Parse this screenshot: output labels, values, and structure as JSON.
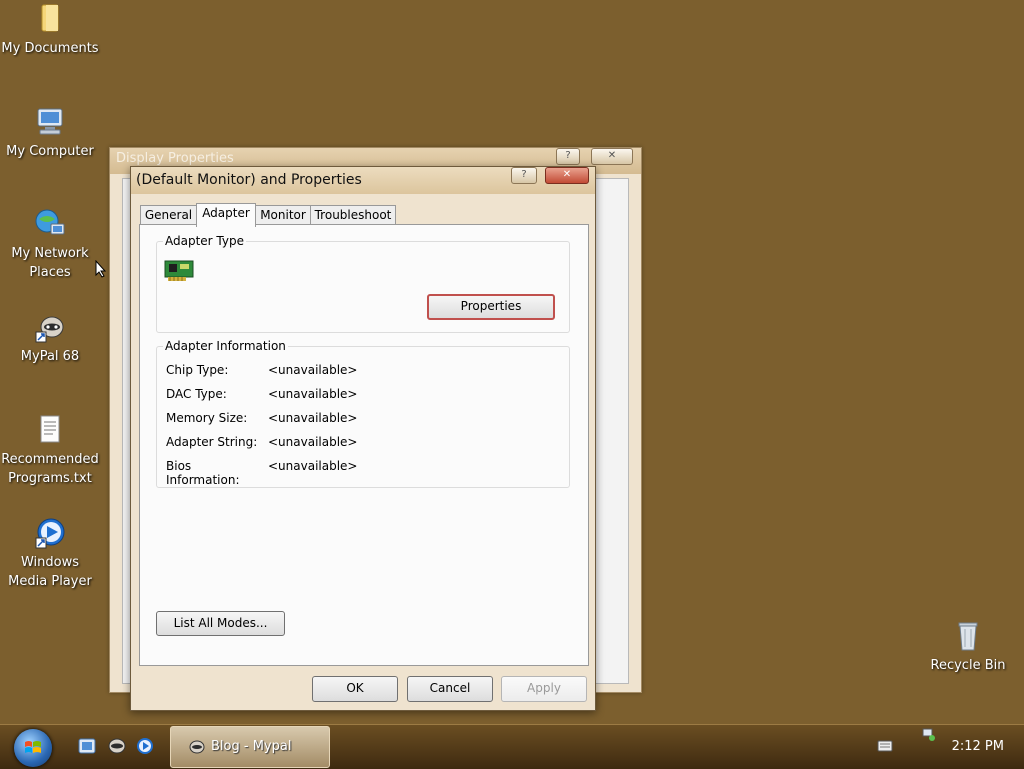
{
  "desktop": {
    "icons": [
      {
        "label": "My Documents",
        "icon": "folder-icon"
      },
      {
        "label": "My Computer",
        "icon": "computer-icon"
      },
      {
        "label": "My Network Places",
        "icon": "network-icon"
      },
      {
        "label": "MyPal 68",
        "icon": "mypal-icon"
      },
      {
        "label": "Recommended Programs.txt",
        "icon": "text-file-icon"
      },
      {
        "label": "Windows Media Player",
        "icon": "media-player-icon"
      },
      {
        "label": "Recycle Bin",
        "icon": "recycle-bin-icon"
      }
    ]
  },
  "back_window": {
    "title": "Display Properties",
    "help_label": "?",
    "close_label": "✕"
  },
  "dialog": {
    "title": "(Default Monitor) and  Properties",
    "help_label": "?",
    "close_label": "✕",
    "tabs": [
      {
        "label": "General"
      },
      {
        "label": "Adapter"
      },
      {
        "label": "Monitor"
      },
      {
        "label": "Troubleshoot"
      }
    ],
    "active_tab": "Adapter",
    "adapter_type": {
      "title": "Adapter Type",
      "properties_label": "Properties"
    },
    "adapter_info": {
      "title": "Adapter Information",
      "rows": [
        {
          "key": "Chip Type:",
          "value": "<unavailable>"
        },
        {
          "key": "DAC Type:",
          "value": "<unavailable>"
        },
        {
          "key": "Memory Size:",
          "value": "<unavailable>"
        },
        {
          "key": "Adapter String:",
          "value": "<unavailable>"
        },
        {
          "key": "Bios Information:",
          "value": "<unavailable>"
        }
      ]
    },
    "list_modes_label": "List All Modes...",
    "ok_label": "OK",
    "cancel_label": "Cancel",
    "apply_label": "Apply"
  },
  "taskbar": {
    "task_label": "Blog - Mypal",
    "clock": "2:12 PM"
  },
  "colors": {
    "desktop": "#7c5f2e",
    "dialog_bg": "#efe3cf",
    "focus_border": "#c0504d",
    "close_button": "#c24b35"
  }
}
